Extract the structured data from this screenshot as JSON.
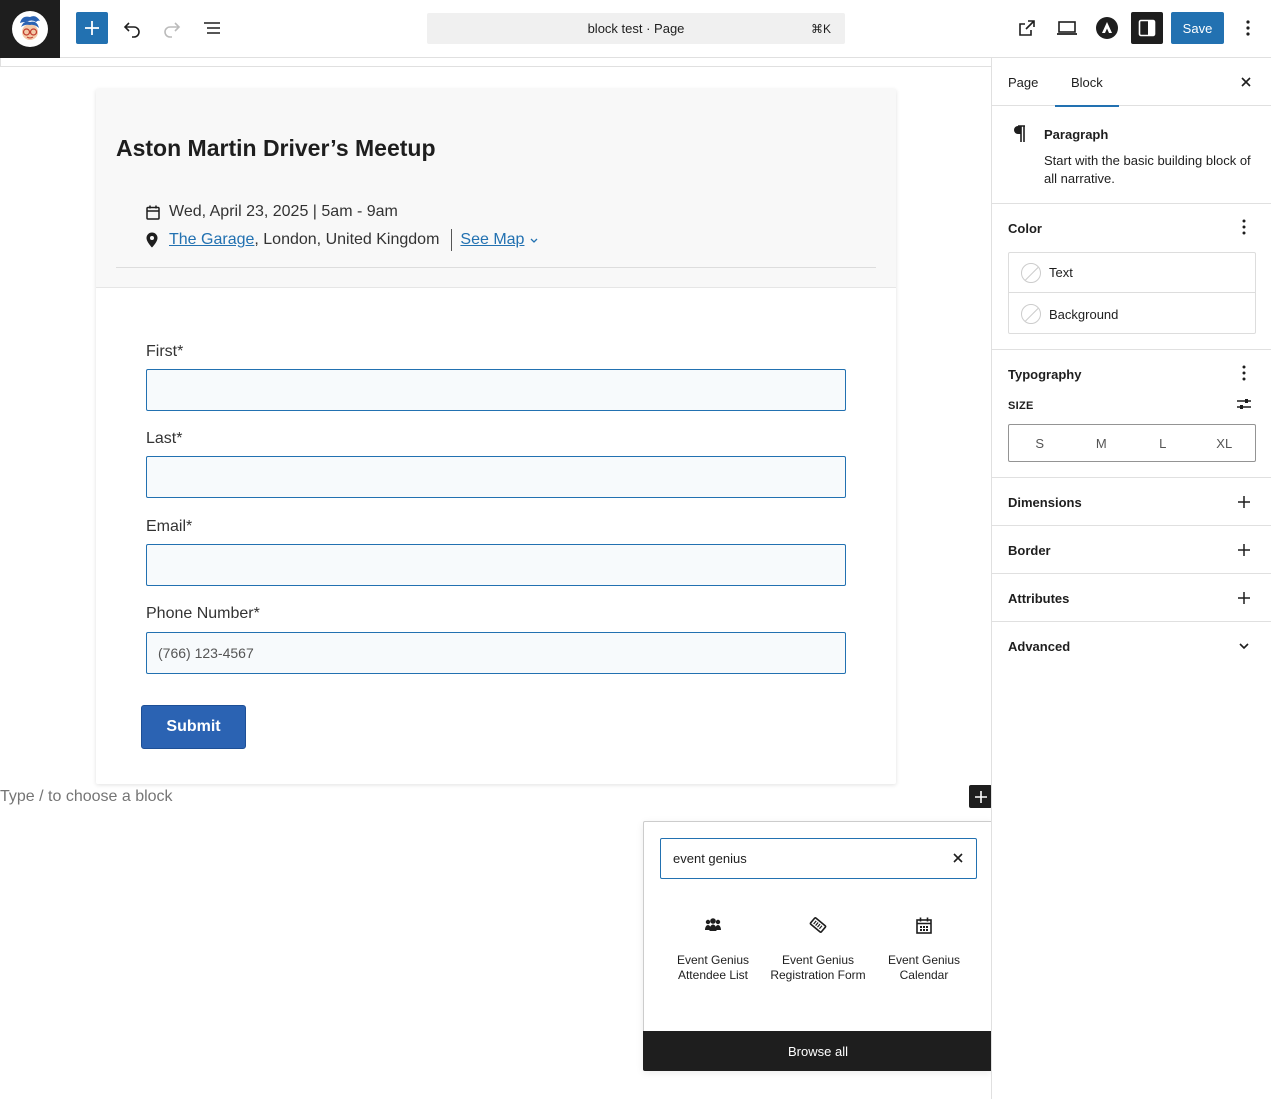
{
  "toolbar": {
    "command_bar_text": "block test · Page",
    "command_shortcut": "⌘K",
    "save_label": "Save"
  },
  "event": {
    "title": "Aston Martin Driver’s Meetup",
    "datetime": "Wed, April 23, 2025 | 5am - 9am",
    "venue_link": "The Garage",
    "venue_rest": ", London, United Kingdom",
    "map_link": "See Map"
  },
  "form": {
    "fields": [
      {
        "label": "First*",
        "value": ""
      },
      {
        "label": "Last*",
        "value": ""
      },
      {
        "label": "Email*",
        "value": ""
      },
      {
        "label": "Phone Number*",
        "value": "",
        "placeholder": "(766) 123-4567"
      }
    ],
    "submit_label": "Submit"
  },
  "canvas": {
    "placeholder": "Type / to choose a block"
  },
  "inserter": {
    "search_value": "event genius",
    "items": [
      {
        "label": "Event Genius Attendee List",
        "icon": "group-icon"
      },
      {
        "label": "Event Genius Registration Form",
        "icon": "ticket-icon"
      },
      {
        "label": "Event Genius Calendar",
        "icon": "calendar-icon"
      }
    ],
    "browse_all_label": "Browse all"
  },
  "sidebar": {
    "tabs": [
      "Page",
      "Block"
    ],
    "active_tab": "Block",
    "block_title": "Paragraph",
    "block_desc": "Start with the basic building block of all narrative.",
    "color_title": "Color",
    "color_items": [
      "Text",
      "Background"
    ],
    "typography_title": "Typography",
    "size_label": "SIZE",
    "size_options": [
      "S",
      "M",
      "L",
      "XL"
    ],
    "panels": [
      "Dimensions",
      "Border",
      "Attributes",
      "Advanced"
    ]
  },
  "colors": {
    "accent": "#2271b1",
    "dark": "#1e1e1e"
  }
}
